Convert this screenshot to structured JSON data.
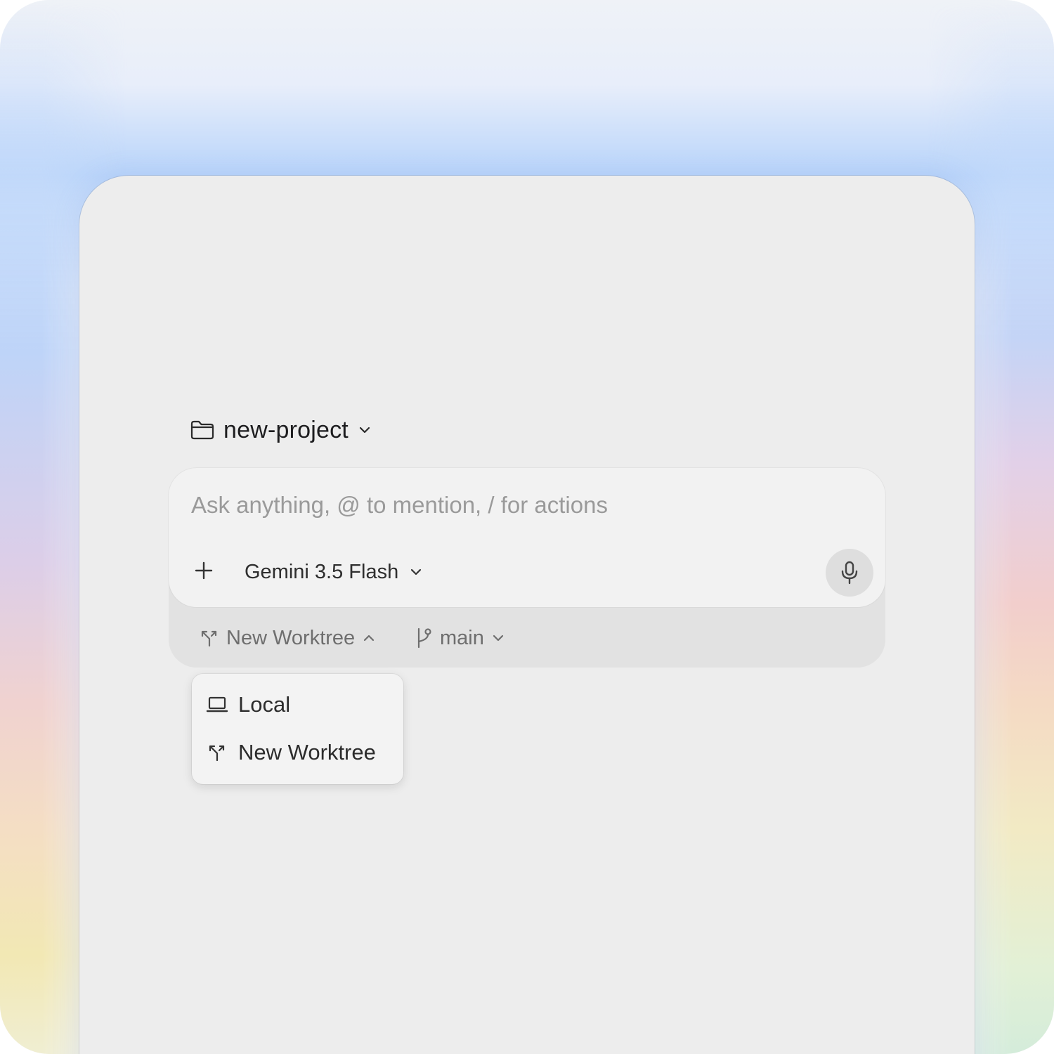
{
  "project": {
    "name": "new-project",
    "folder_icon": "folder-icon",
    "chevron_icon": "chevron-down-icon"
  },
  "composer": {
    "placeholder": "Ask anything, @ to mention, / for actions",
    "add_icon": "plus-icon",
    "model": {
      "label": "Gemini 3.5 Flash",
      "chevron_icon": "chevron-down-icon"
    },
    "mic_icon": "microphone-icon"
  },
  "footer": {
    "worktree": {
      "icon": "worktree-icon",
      "label": "New Worktree",
      "chevron_icon": "chevron-up-icon"
    },
    "branch": {
      "icon": "git-branch-icon",
      "label": "main",
      "chevron_icon": "chevron-down-icon"
    }
  },
  "worktree_menu": {
    "items": [
      {
        "label": "Local",
        "icon": "laptop-icon"
      },
      {
        "label": "New Worktree",
        "icon": "worktree-icon"
      }
    ]
  },
  "colors": {
    "panel_bg": "#ededed",
    "composer_bg": "#f2f2f2",
    "composer_footer_bg": "#e2e2e2",
    "placeholder_text": "#9a9a9a",
    "glow_blue": "#b8d4fa"
  }
}
